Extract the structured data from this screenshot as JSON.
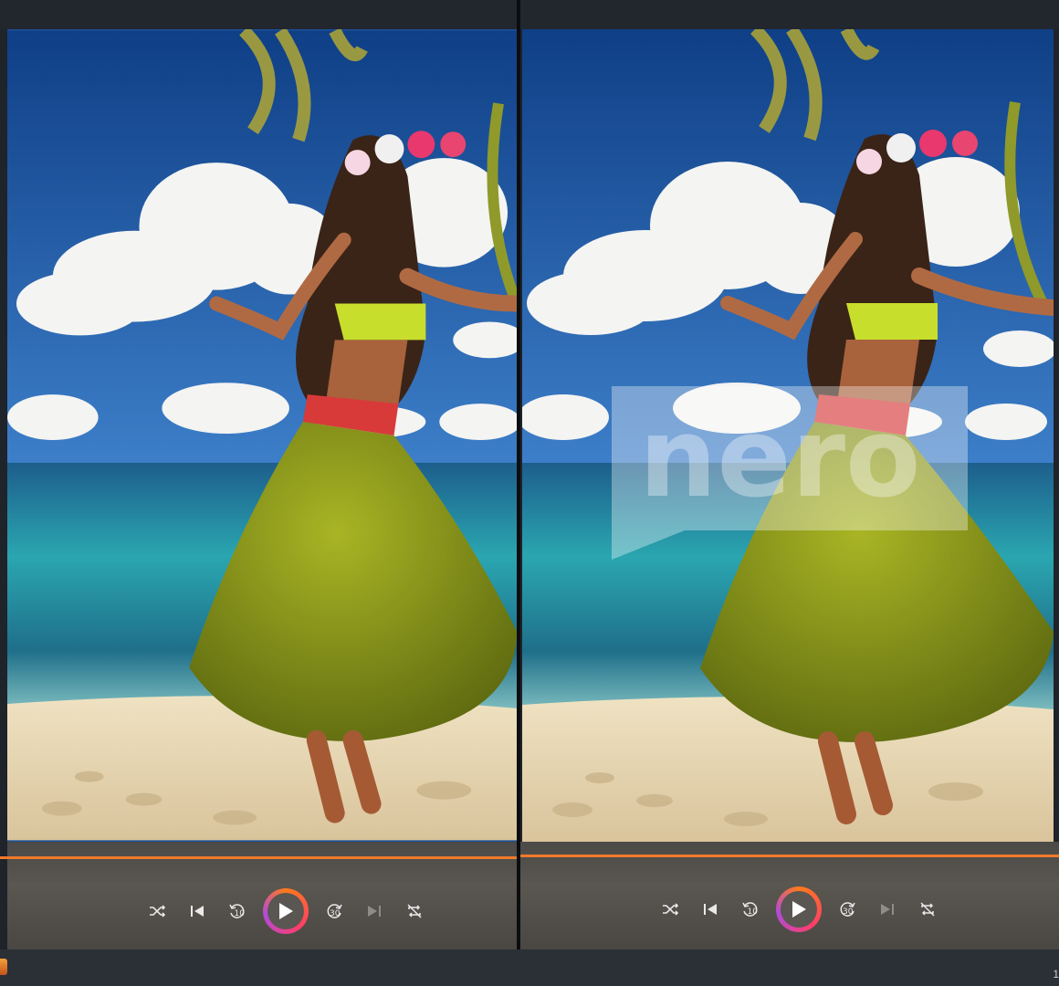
{
  "panes": {
    "left": {
      "label": "original-video",
      "has_watermark": false
    },
    "right": {
      "label": "watermarked-video",
      "has_watermark": true
    }
  },
  "watermark": {
    "brand_text": "nero"
  },
  "player": {
    "progress": 0.0,
    "controls": [
      "shuffle-icon",
      "previous-icon",
      "rewind-10-icon",
      "play-icon",
      "forward-30-icon",
      "next-icon",
      "repeat-off-icon"
    ],
    "rewind_label": "10",
    "forward_label": "30"
  },
  "status": {
    "right_text": "1"
  },
  "colors": {
    "accent": "#f07a2a",
    "play_ring_start": "#ff7a1a",
    "play_ring_end": "#b14ad8"
  }
}
